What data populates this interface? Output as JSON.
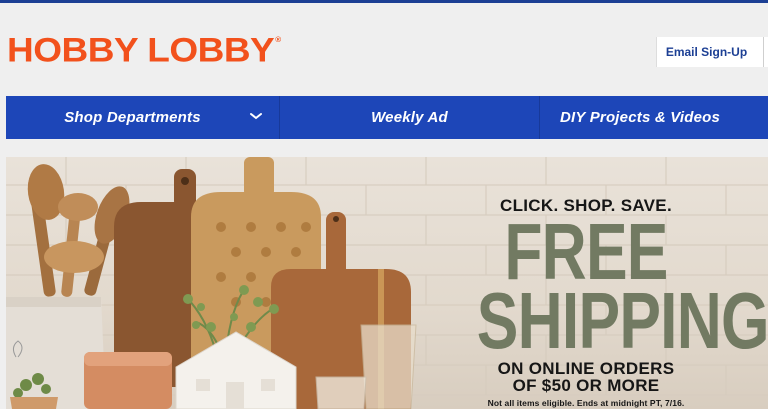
{
  "header": {
    "logo_text": "HOBBY LOBBY",
    "logo_reg": "®",
    "email_signup": "Email Sign-Up"
  },
  "nav": {
    "items": [
      {
        "label": "Shop Departments",
        "has_dropdown": true
      },
      {
        "label": "Weekly Ad"
      },
      {
        "label": "DIY Projects & Videos"
      }
    ]
  },
  "promo": {
    "kicker": "CLICK. SHOP. SAVE.",
    "line1": "FREE",
    "line2": "SHIPPING",
    "sub1": "ON ONLINE ORDERS",
    "sub2": "OF $50 OR MORE",
    "fine_print": "Not all items eligible. Ends at midnight PT, 7/16."
  },
  "colors": {
    "brand_orange": "#f2511c",
    "nav_blue": "#1d46b8",
    "email_text": "#1c3f94",
    "promo_green": "#727a62"
  },
  "icons": {
    "dropdown": "chevron-down-icon"
  }
}
